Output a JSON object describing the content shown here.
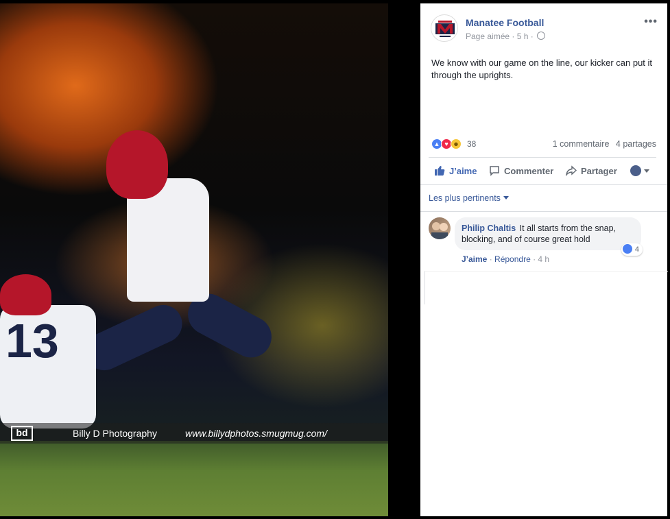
{
  "photo": {
    "holder_number": "13",
    "watermark_logo": "bd",
    "watermark_name": "Billy D Photography",
    "watermark_url": "www.billydphotos.smugmug.com/"
  },
  "post": {
    "page_name": "Manatee Football",
    "page_status": "Page aimée",
    "time": "5 h",
    "more_icon": "more-horizontal-icon",
    "text": "We know with our game on the line, our kicker can put it through the uprights.",
    "reactions_count": "38",
    "comments_count": "1 commentaire",
    "shares_count": "4 partages",
    "actions": {
      "like": "J’aime",
      "comment": "Commenter",
      "share": "Partager"
    },
    "sort_label": "Les plus pertinents"
  },
  "comment": {
    "author": "Philip Chaltis",
    "text": "It all starts from the snap, blocking, and of course great hold",
    "likes": "4",
    "like_label": "J’aime",
    "reply_label": "Répondre",
    "time": "4 h"
  },
  "colors": {
    "link": "#385898",
    "like_blue": "#4267b2",
    "love_red": "#f0284a",
    "haha_yellow": "#f7c638"
  }
}
